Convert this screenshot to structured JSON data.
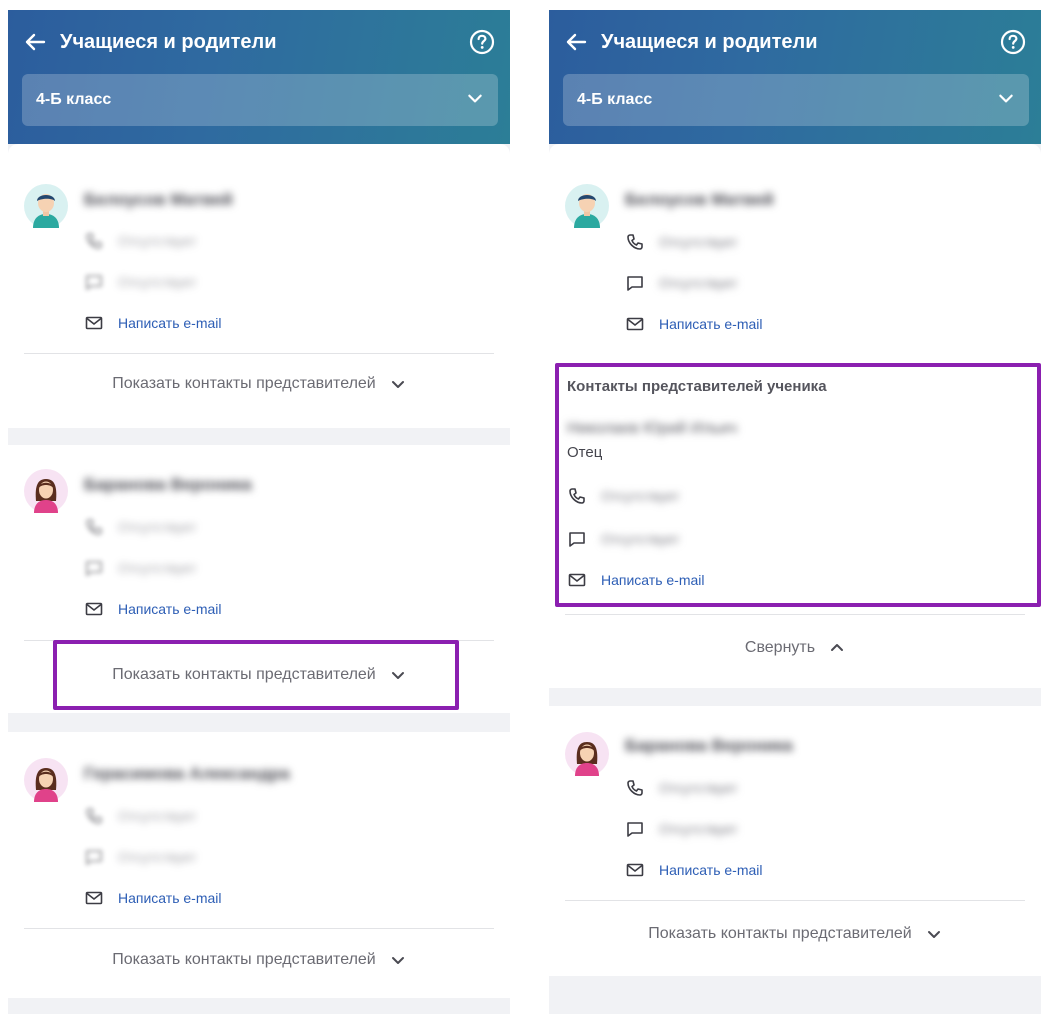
{
  "header": {
    "title": "Учащиеся и родители",
    "class_selected": "4-Б класс"
  },
  "actions": {
    "write_email": "Написать e-mail",
    "show_contacts": "Показать контакты представителей",
    "collapse": "Свернуть"
  },
  "students": [
    {
      "name": "Белоусов Матвей",
      "phone": "Отсутствует",
      "message": "Отсутствует",
      "avatar": "boy-avatar-icon"
    },
    {
      "name": "Баранова Вероника",
      "phone": "Отсутствует",
      "message": "Отсутствует",
      "avatar": "girl-avatar-icon"
    },
    {
      "name": "Герасимова Александра",
      "phone": "Отсутствует",
      "message": "Отсутствует",
      "avatar": "girl-avatar-icon"
    }
  ],
  "representatives": {
    "section_title": "Контакты представителей ученика",
    "name": "Николаев Юрий Ильич",
    "role": "Отец",
    "phone": "Отсутствует",
    "message": "Отсутствует"
  },
  "colors": {
    "header_gradient_start": "#2c5d9d",
    "header_gradient_end": "#2c7e97",
    "link": "#2d5eb5",
    "highlight": "#8b1fb0"
  }
}
